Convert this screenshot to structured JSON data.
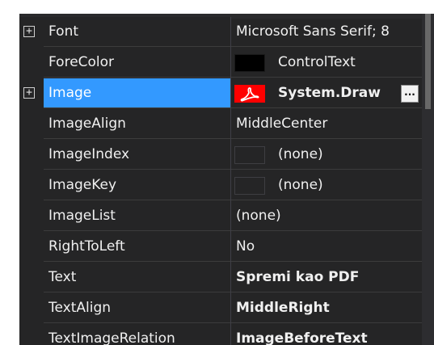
{
  "properties": [
    {
      "name": "Font",
      "value": "Microsoft Sans Serif; 8",
      "expandable": true,
      "bold": false,
      "swatch": "none"
    },
    {
      "name": "ForeColor",
      "value": "ControlText",
      "expandable": false,
      "bold": false,
      "swatch": "black"
    },
    {
      "name": "Image",
      "value": "System.Draw",
      "expandable": true,
      "bold": true,
      "swatch": "pdf",
      "selected": true,
      "ellipsis": "..."
    },
    {
      "name": "ImageAlign",
      "value": "MiddleCenter",
      "expandable": false,
      "bold": false,
      "swatch": "none"
    },
    {
      "name": "ImageIndex",
      "value": "(none)",
      "expandable": false,
      "bold": false,
      "swatch": "empty"
    },
    {
      "name": "ImageKey",
      "value": "(none)",
      "expandable": false,
      "bold": false,
      "swatch": "empty"
    },
    {
      "name": "ImageList",
      "value": "(none)",
      "expandable": false,
      "bold": false,
      "swatch": "none"
    },
    {
      "name": "RightToLeft",
      "value": "No",
      "expandable": false,
      "bold": false,
      "swatch": "none"
    },
    {
      "name": "Text",
      "value": "Spremi kao PDF",
      "expandable": false,
      "bold": true,
      "swatch": "none"
    },
    {
      "name": "TextAlign",
      "value": "MiddleRight",
      "expandable": false,
      "bold": true,
      "swatch": "none"
    },
    {
      "name": "TextImageRelation",
      "value": "ImageBeforeText",
      "expandable": false,
      "bold": true,
      "swatch": "none"
    }
  ],
  "expander_glyph": "+",
  "colors": {
    "background": "#252526",
    "selected": "#3399ff",
    "text": "#f0f0f0",
    "pdf_icon": "#ff0000"
  }
}
